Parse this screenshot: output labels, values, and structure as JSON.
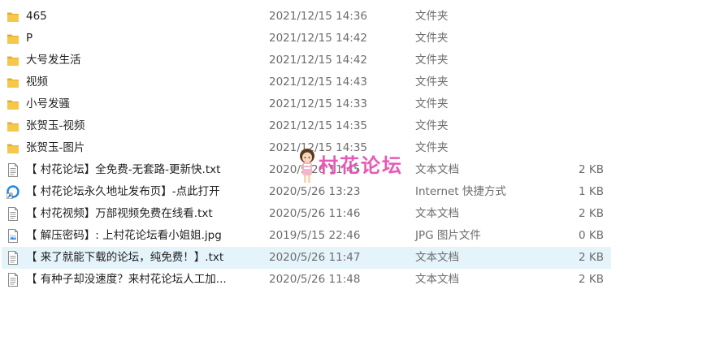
{
  "files": [
    {
      "icon": "folder-icon",
      "name": "465",
      "date": "2021/12/15 14:36",
      "type": "文件夹",
      "size": ""
    },
    {
      "icon": "folder-icon",
      "name": "P",
      "date": "2021/12/15 14:42",
      "type": "文件夹",
      "size": ""
    },
    {
      "icon": "folder-icon",
      "name": "大号发生活",
      "date": "2021/12/15 14:42",
      "type": "文件夹",
      "size": ""
    },
    {
      "icon": "folder-icon",
      "name": "视频",
      "date": "2021/12/15 14:43",
      "type": "文件夹",
      "size": ""
    },
    {
      "icon": "folder-icon",
      "name": "小号发骚",
      "date": "2021/12/15 14:33",
      "type": "文件夹",
      "size": ""
    },
    {
      "icon": "folder-icon",
      "name": "张贺玉-视频",
      "date": "2021/12/15 14:35",
      "type": "文件夹",
      "size": ""
    },
    {
      "icon": "folder-icon",
      "name": "张贺玉-图片",
      "date": "2021/12/15 14:35",
      "type": "文件夹",
      "size": ""
    },
    {
      "icon": "text-file-icon",
      "name": "【 村花论坛】全免费-无套路-更新快.txt",
      "date": "2020/5/26 11:45",
      "type": "文本文档",
      "size": "2 KB"
    },
    {
      "icon": "internet-shortcut-icon",
      "name": "【 村花论坛永久地址发布页】-点此打开",
      "date": "2020/5/26 13:23",
      "type": "Internet 快捷方式",
      "size": "1 KB"
    },
    {
      "icon": "text-file-icon",
      "name": "【 村花视频】万部视频免费在线看.txt",
      "date": "2020/5/26 11:46",
      "type": "文本文档",
      "size": "2 KB"
    },
    {
      "icon": "image-file-icon",
      "name": "【 解压密码】: 上村花论坛看小姐姐.jpg",
      "date": "2019/5/15 22:46",
      "type": "JPG 图片文件",
      "size": "0 KB"
    },
    {
      "icon": "text-file-icon",
      "name": "【 来了就能下载的论坛，纯免费！】.txt",
      "date": "2020/5/26 11:47",
      "type": "文本文档",
      "size": "2 KB",
      "selected": true
    },
    {
      "icon": "text-file-icon",
      "name": "【 有种子却没速度？来村花论坛人工加...",
      "date": "2020/5/26 11:48",
      "type": "文本文档",
      "size": "2 KB"
    }
  ],
  "watermark": {
    "text": "村花论坛"
  },
  "colors": {
    "folder": "#f4c23f",
    "selection": "#e5f3fb",
    "watermark": "#e64db0"
  }
}
